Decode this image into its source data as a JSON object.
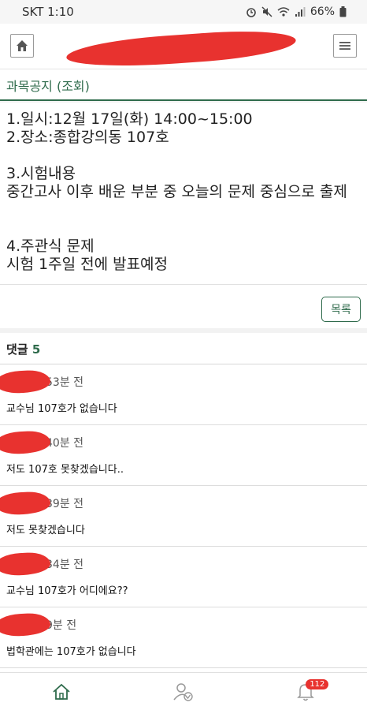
{
  "status_bar": {
    "carrier_time": "SKT 1:10",
    "battery": "66%",
    "icons": [
      "alarm-icon",
      "mute-icon",
      "wifi-icon",
      "signal-icon",
      "battery-icon"
    ]
  },
  "header": {
    "home_icon": "home-icon",
    "menu_icon": "menu-icon"
  },
  "section": {
    "title": "과목공지 (조회)"
  },
  "notice": {
    "body": "1.일시:12월 17일(화) 14:00~15:00\n2.장소:종합강의동 107호\n\n3.시험내용\n중간고사 이후 배운 부분 중 오늘의 문제 중심으로 출제\n\n\n4.주관식 문제\n시험 1주일 전에 발표예정"
  },
  "list_button": "목록",
  "comments": {
    "label": "댓글",
    "count": "5",
    "items": [
      {
        "time": "53분 전",
        "text": "교수님 107호가 없습니다"
      },
      {
        "time": "40분 전",
        "text": "저도 107호 못찾겠습니다.."
      },
      {
        "time": "39분 전",
        "text": "저도 못찾겠습니다"
      },
      {
        "time": "34분 전",
        "text": "교수님 107호가 어디에요??"
      },
      {
        "time": "9분 전",
        "text": "법학관에는 107호가 없습니다"
      }
    ]
  },
  "bottom_nav": {
    "items": [
      "home-icon",
      "user-check-icon",
      "bell-icon"
    ],
    "notification_count": "112"
  },
  "colors": {
    "accent": "#2f6b4c",
    "redaction": "#e8322f"
  }
}
